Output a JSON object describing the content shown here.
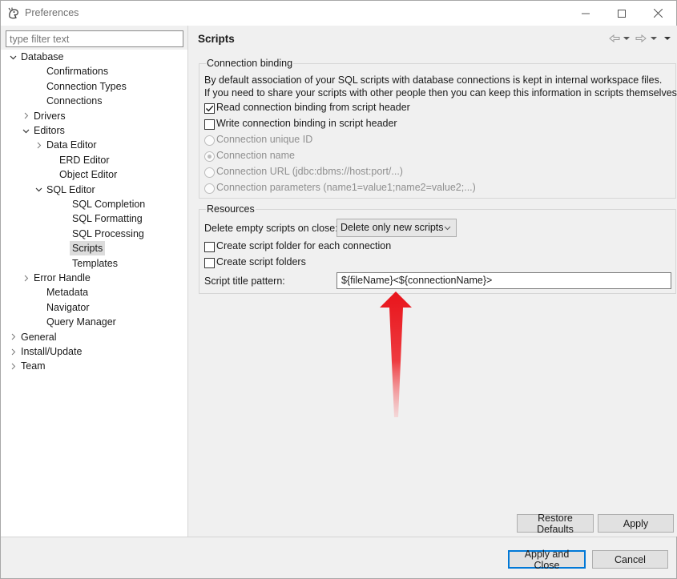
{
  "window": {
    "title": "Preferences",
    "controls": {
      "minimize": "—",
      "maximize": "☐",
      "close": "✕"
    }
  },
  "filter": {
    "placeholder": "type filter text"
  },
  "tree": {
    "items": [
      {
        "label": "Database",
        "expander": "expanded",
        "level": 0
      },
      {
        "label": "Confirmations",
        "expander": "none",
        "level": 2
      },
      {
        "label": "Connection Types",
        "expander": "none",
        "level": 2
      },
      {
        "label": "Connections",
        "expander": "none",
        "level": 2
      },
      {
        "label": "Drivers",
        "expander": "collapsed",
        "level": 1
      },
      {
        "label": "Editors",
        "expander": "expanded",
        "level": 1
      },
      {
        "label": "Data Editor",
        "expander": "collapsed",
        "level": 2
      },
      {
        "label": "ERD Editor",
        "expander": "none",
        "level": 3
      },
      {
        "label": "Object Editor",
        "expander": "none",
        "level": 3
      },
      {
        "label": "SQL Editor",
        "expander": "expanded",
        "level": 2
      },
      {
        "label": "SQL Completion",
        "expander": "none",
        "level": 4
      },
      {
        "label": "SQL Formatting",
        "expander": "none",
        "level": 4
      },
      {
        "label": "SQL Processing",
        "expander": "none",
        "level": 4
      },
      {
        "label": "Scripts",
        "expander": "none",
        "level": 4,
        "selected": true
      },
      {
        "label": "Templates",
        "expander": "none",
        "level": 4
      },
      {
        "label": "Error Handle",
        "expander": "collapsed",
        "level": 1
      },
      {
        "label": "Metadata",
        "expander": "none",
        "level": 2
      },
      {
        "label": "Navigator",
        "expander": "none",
        "level": 2
      },
      {
        "label": "Query Manager",
        "expander": "none",
        "level": 2
      },
      {
        "label": "General",
        "expander": "collapsed",
        "level": 0
      },
      {
        "label": "Install/Update",
        "expander": "collapsed",
        "level": 0
      },
      {
        "label": "Team",
        "expander": "collapsed",
        "level": 0
      }
    ]
  },
  "page": {
    "title": "Scripts",
    "nav": {
      "back": "⇦",
      "forward": "⇨",
      "dropdown": "▾",
      "menu": "▾"
    }
  },
  "connection_binding": {
    "title": "Connection binding",
    "description_line1": "By default association of your SQL scripts with database connections is kept in internal workspace files.",
    "description_line2": "If you need to share your scripts with other people then you can keep this information in scripts themselves.",
    "read_header": {
      "label": "Read connection binding from script header",
      "checked": true
    },
    "write_header": {
      "label": "Write connection binding in script header",
      "checked": false
    },
    "options": [
      {
        "label": "Connection unique ID",
        "checked": false,
        "enabled": false
      },
      {
        "label": "Connection name",
        "checked": true,
        "enabled": false
      },
      {
        "label": "Connection URL (jdbc:dbms://host:port/...)",
        "checked": false,
        "enabled": false
      },
      {
        "label": "Connection parameters (name1=value1;name2=value2;...)",
        "checked": false,
        "enabled": false
      }
    ]
  },
  "resources": {
    "title": "Resources",
    "delete_label": "Delete empty scripts on close:",
    "delete_value": "Delete only new scripts",
    "create_per_connection": {
      "label": "Create script folder for each connection",
      "checked": false
    },
    "create_folders": {
      "label": "Create script folders",
      "checked": false
    },
    "title_pattern_label": "Script title pattern:",
    "title_pattern_value": "${fileName}<${connectionName}>"
  },
  "buttons": {
    "restore_defaults": "Restore Defaults",
    "apply": "Apply",
    "apply_close": "Apply and Close",
    "cancel": "Cancel"
  },
  "colors": {
    "accent": "#0078d7",
    "arrow": "#e8141b",
    "selection": "#dcdcdc"
  }
}
